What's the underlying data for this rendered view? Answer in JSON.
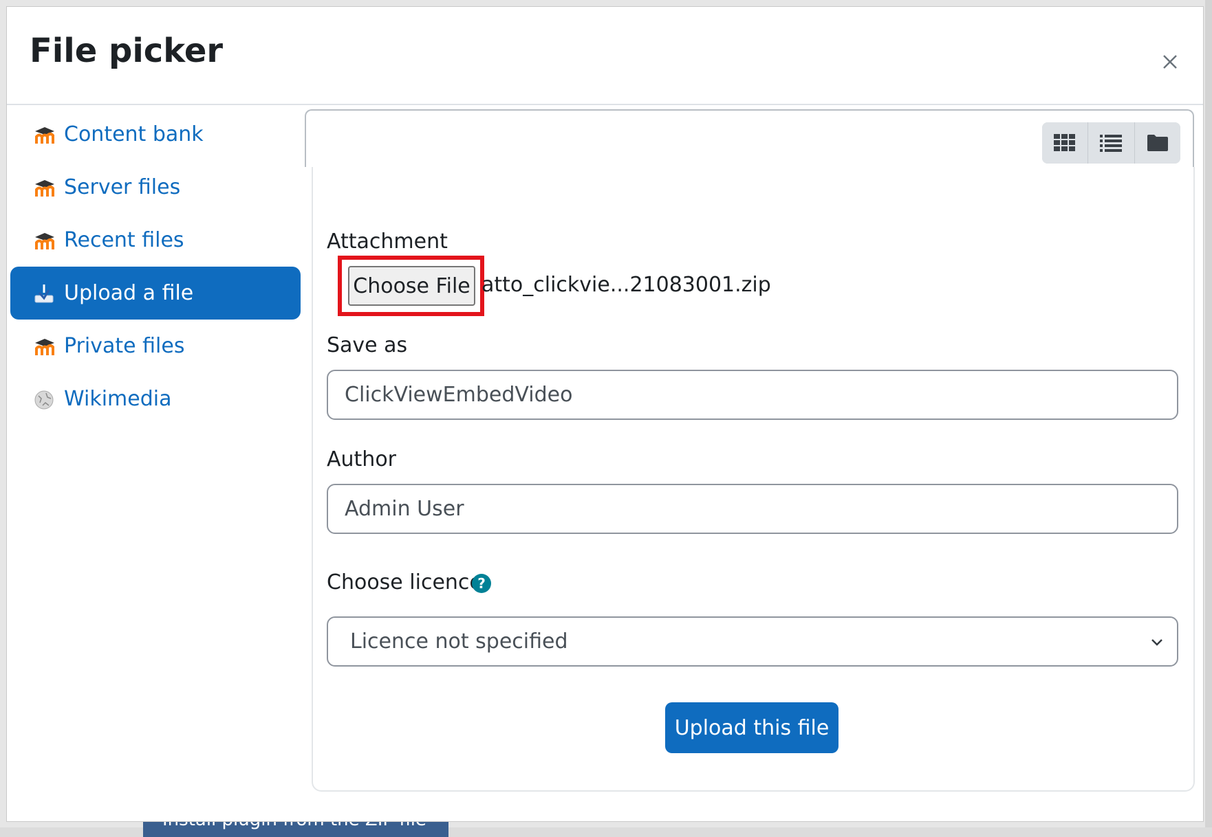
{
  "background": {
    "strip_text": "Install plugin from the ZIP file"
  },
  "dialog": {
    "title": "File picker",
    "close_icon": "close-icon"
  },
  "sidebar": {
    "items": [
      {
        "label": "Content bank",
        "icon": "moodle-icon",
        "active": false
      },
      {
        "label": "Server files",
        "icon": "moodle-icon",
        "active": false
      },
      {
        "label": "Recent files",
        "icon": "moodle-icon",
        "active": false
      },
      {
        "label": "Upload a file",
        "icon": "upload-icon",
        "active": true
      },
      {
        "label": "Private files",
        "icon": "moodle-icon",
        "active": false
      },
      {
        "label": "Wikimedia",
        "icon": "wikimedia-globe-icon",
        "active": false
      }
    ]
  },
  "toolbar": {
    "views": [
      {
        "icon": "grid-view-icon"
      },
      {
        "icon": "list-view-icon"
      },
      {
        "icon": "folder-view-icon"
      }
    ]
  },
  "form": {
    "attachment_label": "Attachment",
    "choose_file_label": "Choose File",
    "selected_file": "atto_clickvie...21083001.zip",
    "save_as_label": "Save as",
    "save_as_value": "ClickViewEmbedVideo",
    "author_label": "Author",
    "author_value": "Admin User",
    "licence_label": "Choose licence",
    "licence_value": "Licence not specified",
    "upload_button": "Upload this file"
  },
  "colors": {
    "primary": "#0f6cbf",
    "highlight": "#e3141b",
    "moodle_orange": "#f98012"
  }
}
